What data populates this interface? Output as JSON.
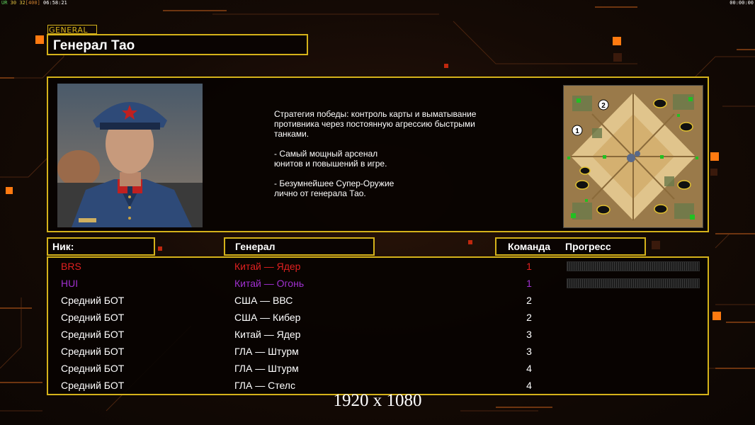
{
  "topbar": {
    "fps_label": "ÜR",
    "fps_a": "30",
    "fps_b": "32",
    "fps_c": "[400]",
    "clock": "06:58:21",
    "timer": "00:00:00"
  },
  "general": {
    "tag": "GENERAL",
    "name": "Генерал Тао",
    "description": "Стратегия победы: контроль карты и выматывание\n противника через постоянную агрессию быстрыми\n танками.\n\n- Самый мощный арсенал\nюнитов и повышений в игре.\n\n- Безумнейшее Супер-Оружие\nлично от генерала Тао."
  },
  "headers": {
    "nick": "Ник:",
    "general": "Генерал",
    "team": "Команда",
    "progress": "Прогресс"
  },
  "players": [
    {
      "nick": "BRS",
      "general": "Китай — Ядер",
      "team": "1",
      "color": "#e02020",
      "progress": true
    },
    {
      "nick": "HUI",
      "general": "Китай — Огонь",
      "team": "1",
      "color": "#a030d0",
      "progress": true
    },
    {
      "nick": "Средний БОТ",
      "general": "США — ВВС",
      "team": "2",
      "color": "#ffffff",
      "progress": false
    },
    {
      "nick": "Средний БОТ",
      "general": "США — Кибер",
      "team": "2",
      "color": "#ffffff",
      "progress": false
    },
    {
      "nick": "Средний БОТ",
      "general": "Китай — Ядер",
      "team": "3",
      "color": "#ffffff",
      "progress": false
    },
    {
      "nick": "Средний БОТ",
      "general": "ГЛА — Штурм",
      "team": "3",
      "color": "#ffffff",
      "progress": false
    },
    {
      "nick": "Средний БОТ",
      "general": "ГЛА — Штурм",
      "team": "4",
      "color": "#ffffff",
      "progress": false
    },
    {
      "nick": "Средний БОТ",
      "general": "ГЛА — Стелс",
      "team": "4",
      "color": "#ffffff",
      "progress": false
    }
  ],
  "minimap": {
    "markers": [
      "1",
      "2"
    ]
  },
  "resolution": "1920 x 1080",
  "colors": {
    "accent": "#d4b21a",
    "orange": "#ff7a10"
  }
}
